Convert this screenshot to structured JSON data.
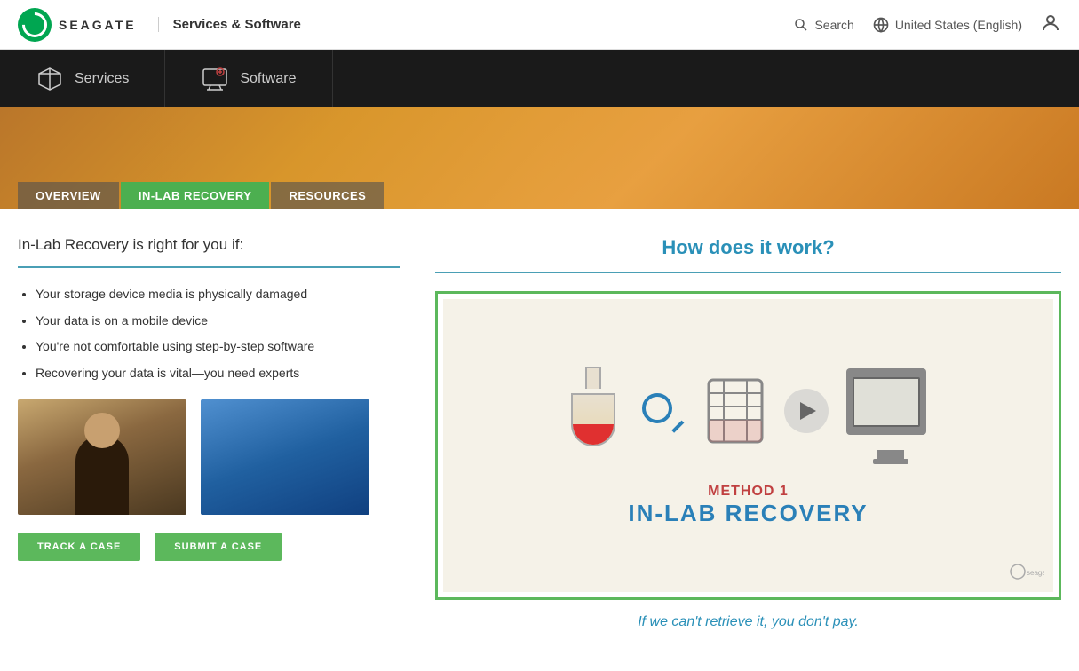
{
  "header": {
    "logo_text": "SEAGATE",
    "nav_title": "Services & Software",
    "search_label": "Search",
    "locale_label": "United States (English)"
  },
  "nav": {
    "items": [
      {
        "id": "services",
        "label": "Services",
        "icon": "cube-icon"
      },
      {
        "id": "software",
        "label": "Software",
        "icon": "display-icon"
      }
    ]
  },
  "hero": {
    "tabs": [
      {
        "id": "overview",
        "label": "OVERVIEW",
        "active": false
      },
      {
        "id": "inlab",
        "label": "IN-LAB RECOVERY",
        "active": true
      },
      {
        "id": "resources",
        "label": "RESOURCES",
        "active": false
      }
    ]
  },
  "left": {
    "intro_text": "In-Lab Recovery is right for you if:",
    "bullets": [
      "Your storage device media is physically damaged",
      "Your data is on a mobile device",
      "You're not comfortable using step-by-step software",
      "Recovering your data is vital—you need experts"
    ],
    "track_btn": "TRACK A CASE",
    "submit_btn": "SUBMIT A CASE"
  },
  "right": {
    "how_title": "How does it work?",
    "video": {
      "method_label": "METHOD 1",
      "recovery_label": "IN-LAB RECOVERY",
      "watermark": "seagate"
    },
    "tagline": "If we can't retrieve it, you don't pay."
  }
}
